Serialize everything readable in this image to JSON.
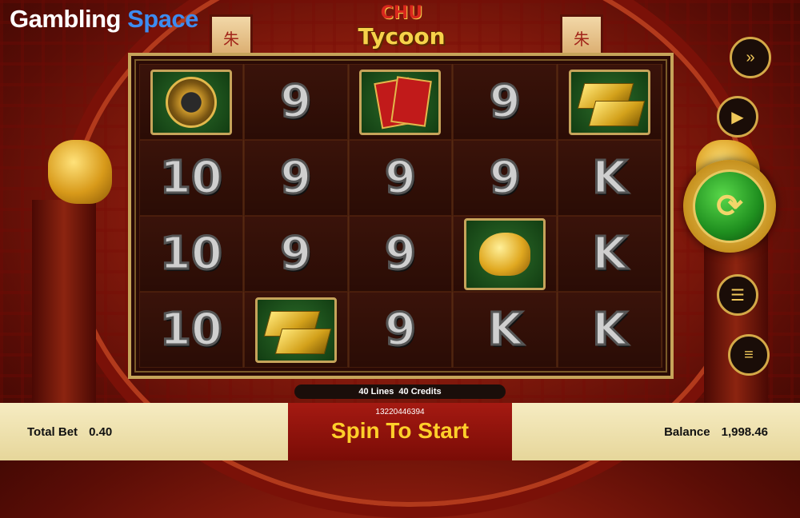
{
  "brand": {
    "part1": "Gambling",
    "part2": "Space"
  },
  "game_logo": {
    "line1": "CHU",
    "line2": "Tycoon"
  },
  "lanterns": [
    "朱",
    "朱"
  ],
  "reels": {
    "rows": [
      [
        "compass",
        "9",
        "red-envelopes",
        "9",
        "gold-bars"
      ],
      [
        "10",
        "9",
        "9",
        "9",
        "K"
      ],
      [
        "10",
        "9",
        "9",
        "gold-pig",
        "K"
      ],
      [
        "10",
        "gold-bars",
        "9",
        "K",
        "K"
      ]
    ]
  },
  "side_buttons": {
    "turbo": "fast-forward-icon",
    "autoplay": "autoplay-icon",
    "spin": "spin-icon",
    "bet": "coin-stack-icon",
    "menu": "menu-icon"
  },
  "lines_bar": {
    "lines": "40 Lines",
    "credits": "40 Credits"
  },
  "bottom": {
    "total_bet_label": "Total Bet",
    "total_bet_value": "0.40",
    "session_id": "13220446394",
    "cta": "Spin To Start",
    "balance_label": "Balance",
    "balance_value": "1,998.46"
  },
  "colors": {
    "gold": "#c6a45a",
    "cta": "#ffcf2a",
    "brand_blue": "#3d8cf0",
    "spin_green": "#1f8f1f"
  }
}
